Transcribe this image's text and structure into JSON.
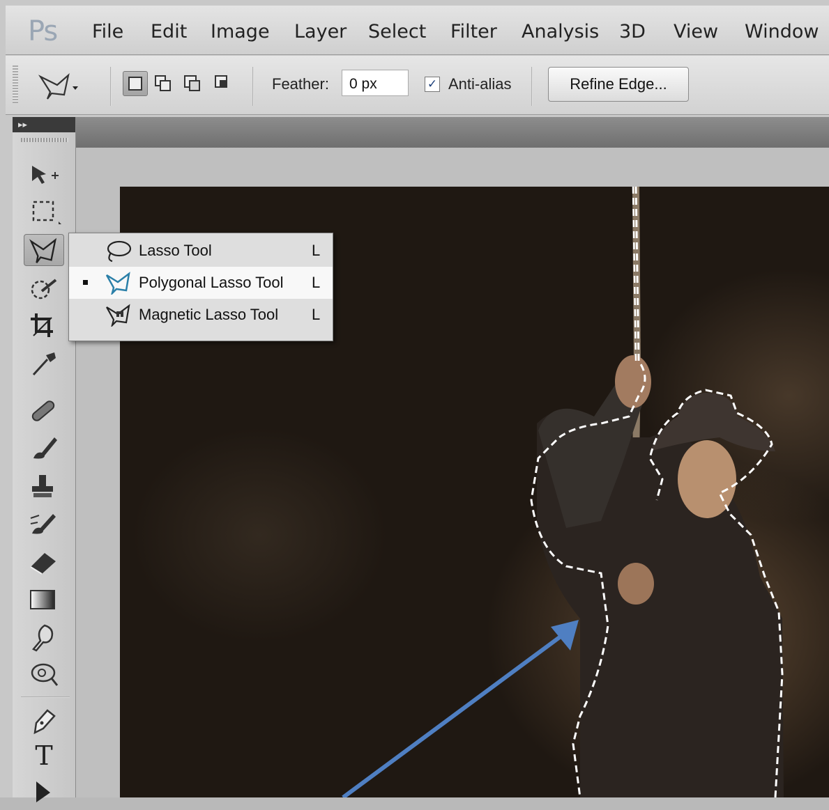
{
  "app": {
    "logo": "Ps"
  },
  "menu": [
    "File",
    "Edit",
    "Image",
    "Layer",
    "Select",
    "Filter",
    "Analysis",
    "3D",
    "View",
    "Window"
  ],
  "options": {
    "tool_preset_icon": "polygonal-lasso-icon",
    "selection_modes": [
      "new-selection-icon",
      "add-to-selection-icon",
      "subtract-from-selection-icon",
      "intersect-selection-icon"
    ],
    "feather_label": "Feather:",
    "feather_value": "0 px",
    "antialias_checked": true,
    "antialias_label": "Anti-alias",
    "refine_edge_label": "Refine Edge..."
  },
  "toolbox": {
    "collapse_glyph": "▸▸",
    "tools": [
      "move-tool-icon",
      "marquee-tool-icon",
      "lasso-tool-icon",
      "quick-selection-icon",
      "crop-tool-icon",
      "eyedropper-icon",
      "healing-brush-icon",
      "brush-icon",
      "clone-stamp-icon",
      "history-brush-icon",
      "eraser-icon",
      "gradient-icon",
      "blur-icon",
      "dodge-icon",
      "pen-tool-icon",
      "type-tool-icon",
      "path-selection-icon"
    ],
    "type_glyph": "T"
  },
  "flyout": {
    "items": [
      {
        "label": "Lasso Tool",
        "shortcut": "L",
        "icon": "lasso-icon",
        "selected": false
      },
      {
        "label": "Polygonal Lasso Tool",
        "shortcut": "L",
        "icon": "polygonal-lasso-icon",
        "selected": true
      },
      {
        "label": "Magnetic Lasso Tool",
        "shortcut": "L",
        "icon": "magnetic-lasso-icon",
        "selected": false
      }
    ]
  },
  "colors": {
    "annotation_arrow": "#4f7fc2",
    "menubar": "#dcdcdc"
  }
}
